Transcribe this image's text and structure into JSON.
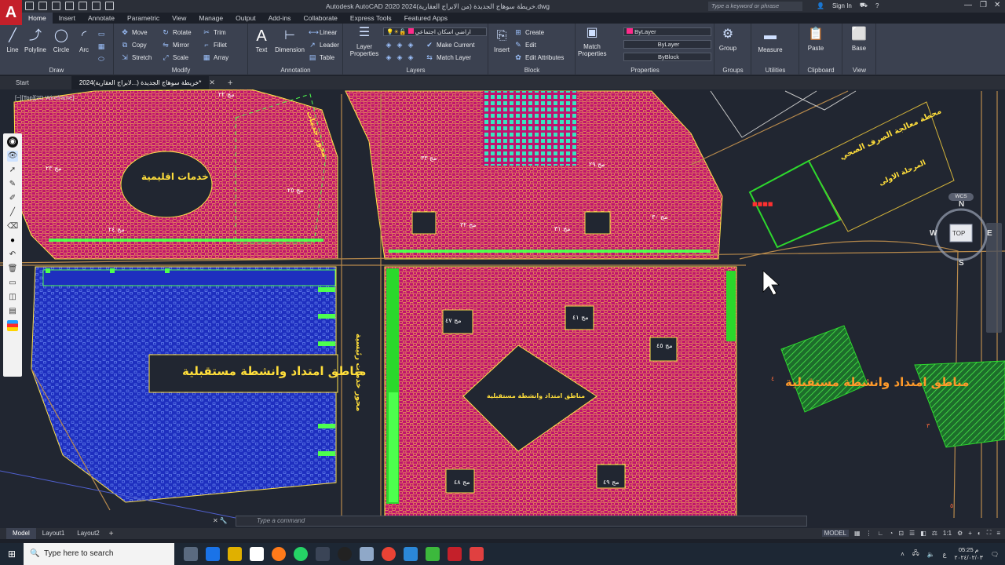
{
  "app": {
    "title": "Autodesk AutoCAD 2020   خريطة سوهاج الجديدة (من الابراج العقارية)2024.dwg",
    "search_placeholder": "Type a keyword or phrase",
    "sign_in": "Sign In"
  },
  "ribbon_tabs": [
    "Home",
    "Insert",
    "Annotate",
    "Parametric",
    "View",
    "Manage",
    "Output",
    "Add-ins",
    "Collaborate",
    "Express Tools",
    "Featured Apps"
  ],
  "draw": {
    "line": "Line",
    "polyline": "Polyline",
    "circle": "Circle",
    "arc": "Arc",
    "title": "Draw"
  },
  "modify": {
    "move": "Move",
    "rotate": "Rotate",
    "trim": "Trim",
    "copy": "Copy",
    "mirror": "Mirror",
    "fillet": "Fillet",
    "stretch": "Stretch",
    "scale": "Scale",
    "array": "Array",
    "title": "Modify"
  },
  "annotation": {
    "text": "Text",
    "dimension": "Dimension",
    "linear": "Linear",
    "leader": "Leader",
    "table": "Table",
    "title": "Annotation"
  },
  "layers": {
    "layer_props": "Layer Properties",
    "current_layer": "اراضي اسكان اجتماعي",
    "make_current": "Make Current",
    "match_layer": "Match Layer",
    "title": "Layers"
  },
  "block": {
    "insert": "Insert",
    "create": "Create",
    "edit": "Edit",
    "edit_attributes": "Edit Attributes",
    "title": "Block"
  },
  "properties": {
    "match": "Match Properties",
    "color": "ByLayer",
    "linetype": "ByLayer",
    "lineweight": "ByBlock",
    "title": "Properties"
  },
  "groups": {
    "group": "Group",
    "title": "Groups"
  },
  "utilities": {
    "measure": "Measure",
    "title": "Utilities"
  },
  "clipboard": {
    "paste": "Paste",
    "title": "Clipboard"
  },
  "view_panel": {
    "base": "Base",
    "title": "View"
  },
  "file_tabs": {
    "start": "Start",
    "drawing": "خريطة سوهاج الجديدة (...لابراج العقارية)2024*"
  },
  "viewport_label": "[−][Top][2D Wireframe]",
  "compass": {
    "n": "N",
    "s": "S",
    "e": "E",
    "w": "W",
    "top": "TOP",
    "wcs": "WCS"
  },
  "drawing_labels": {
    "khadamat": "خدمات اقليمية",
    "future1": "مناطق امتداد وانشطة مستقبلية",
    "future2": "مناطق امتداد وانشطة مستقبلية",
    "future3": "مناطق امتداد وانشطة مستقبلية",
    "axis1": "محور خدمات",
    "axis2": "محور خدمات رئيسية",
    "treatment": "محطة معالجة الصرف الصحي",
    "phase1": "المرحلة الاولى",
    "b23": "مج ٢٣",
    "b24": "مج ٢٤",
    "b25": "مج ٢٥",
    "b22": "مج ٢٢",
    "b29": "مج ٢٩",
    "b30": "مج ٣٠",
    "b31": "مج ٣١",
    "b32": "مج ٣٢",
    "b33": "مج ٣٣",
    "b41": "مج ٤١",
    "b45": "مج ٤٥",
    "b47": "مج ٤٧",
    "b48": "مج ٤٨",
    "b49": "مج ٤٩",
    "n3": "٣",
    "n4": "٤",
    "n5": "٥"
  },
  "command_placeholder": "Type a command",
  "layout_tabs": [
    "Model",
    "Layout1",
    "Layout2"
  ],
  "status": {
    "model": "MODEL",
    "scale": "1:1"
  },
  "taskbar": {
    "search": "Type here to search",
    "time": "05:25 م",
    "date": "٢٠٢٤/٠٢/٠٣"
  }
}
